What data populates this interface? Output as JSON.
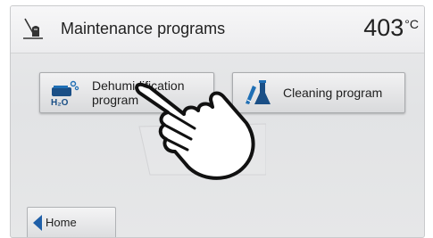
{
  "header": {
    "title": "Maintenance programs",
    "icon": "maintenance-icon",
    "temperature_value": "403",
    "temperature_unit": "°C"
  },
  "buttons": [
    {
      "label": "Dehumidification program",
      "icon": "dehumidification-icon"
    },
    {
      "label": "Cleaning program",
      "icon": "cleaning-icon"
    }
  ],
  "footer": {
    "home_label": "Home",
    "icon": "back-arrow-icon"
  },
  "colors": {
    "accent": "#1f6fb5",
    "dark_blue": "#1a4f86"
  }
}
